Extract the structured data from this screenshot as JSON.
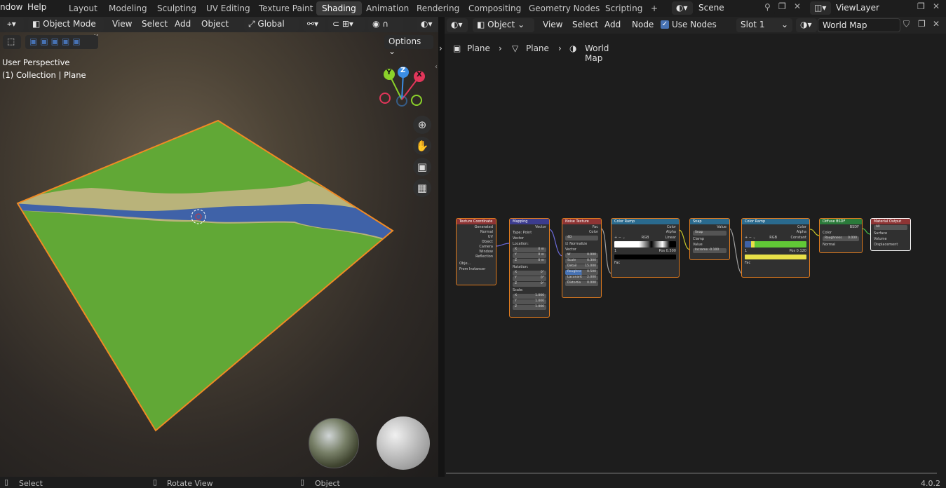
{
  "topbar": {
    "menus": [
      "ndow",
      "Help"
    ],
    "workspaces": [
      "Layout",
      "Modeling",
      "Sculpting",
      "UV Editing",
      "Texture Paint",
      "Shading",
      "Animation",
      "Rendering",
      "Compositing",
      "Geometry Nodes",
      "Scripting"
    ],
    "active_workspace": "Shading",
    "add_tab": "+",
    "scene": "Scene",
    "view_layer": "ViewLayer"
  },
  "viewport": {
    "mode": "Object Mode",
    "menus": [
      "View",
      "Select",
      "Add",
      "Object"
    ],
    "orientation": "Global",
    "options": "Options",
    "perspective_label": "User Perspective",
    "collection_label": "(1) Collection | Plane",
    "gizmo": {
      "x": "X",
      "y": "Y",
      "z": "Z"
    }
  },
  "node_editor": {
    "editor_type": "Object",
    "menus": [
      "View",
      "Select",
      "Add",
      "Node"
    ],
    "use_nodes_label": "Use Nodes",
    "use_nodes_checked": true,
    "slot": "Slot 1",
    "material": "World Map",
    "breadcrumb": [
      "Plane",
      "Plane",
      "World Map"
    ],
    "nodes": {
      "tex_coord": {
        "title": "Texture Coordinate",
        "outputs": [
          "Generated",
          "Normal",
          "UV",
          "Object",
          "Camera",
          "Window",
          "Reflection"
        ],
        "object_label": "Obje...",
        "from_instancer": "From Instancer"
      },
      "mapping": {
        "title": "Mapping",
        "out": "Vector",
        "type_label": "Type:",
        "type_value": "Point",
        "vector": "Vector",
        "location": "Location:",
        "loc": [
          "0 m",
          "0 m",
          "0 m"
        ],
        "rotation": "Rotation:",
        "rot": [
          "0°",
          "0°",
          "0°"
        ],
        "scale": "Scale:",
        "scl": [
          "1.000",
          "1.000",
          "1.000"
        ],
        "axes": [
          "X",
          "Y",
          "Z"
        ]
      },
      "noise": {
        "title": "Noise Texture",
        "outs": [
          "Fac",
          "Color"
        ],
        "dim": "4D",
        "normalize": "Normalize",
        "vector": "Vector",
        "params": [
          [
            "W",
            "0.000"
          ],
          [
            "Scale",
            "0.300"
          ],
          [
            "Detail",
            "15.000"
          ],
          [
            "Roughne",
            "0.500"
          ],
          [
            "Lacunarit",
            "2.000"
          ],
          [
            "Distortio",
            "0.000"
          ]
        ]
      },
      "ramp1": {
        "title": "Color Ramp",
        "outs": [
          "Color",
          "Alpha"
        ],
        "mode": "RGB",
        "interp": "Linear",
        "index": "1",
        "pos_label": "Pos",
        "pos": "0.500",
        "fac": "Fac"
      },
      "snap": {
        "title": "Snap",
        "out": "Value",
        "op": "Snap",
        "value": "Value",
        "clamp": "Clamp",
        "increment": "Increme -0.100"
      },
      "ramp2": {
        "title": "Color Ramp",
        "outs": [
          "Color",
          "Alpha"
        ],
        "mode": "RGB",
        "interp": "Constant",
        "index": "1",
        "pos_label": "Pos",
        "pos": "0.120",
        "fac": "Fac"
      },
      "diffuse": {
        "title": "Diffuse BSDF",
        "out": "BSDF",
        "color": "Color",
        "roughness": "Roughness",
        "roughness_value": "0.000",
        "normal": "Normal"
      },
      "output": {
        "title": "Material Output",
        "target": "All",
        "inputs": [
          "Surface",
          "Volume",
          "Displacement"
        ]
      }
    }
  },
  "statusbar": {
    "items": [
      "Select",
      "Rotate View",
      "Object"
    ],
    "version": "4.0.2"
  },
  "colors": {
    "accent": "#4772b3",
    "selection": "#f08a24",
    "grass": "#61a836",
    "water": "#3f62a8",
    "sand": "#b9b37a"
  }
}
